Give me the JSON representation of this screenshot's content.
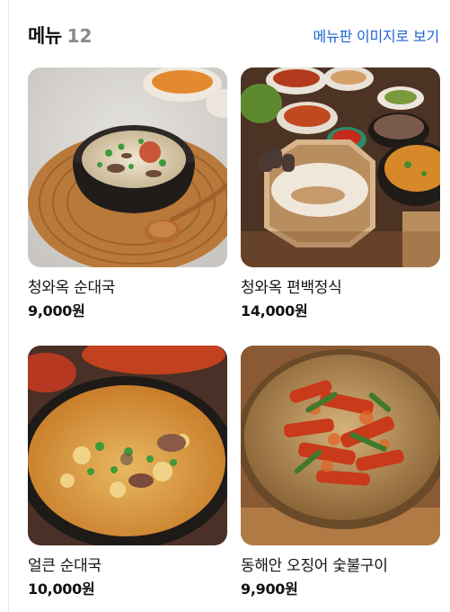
{
  "header": {
    "title": "메뉴",
    "count": "12",
    "view_menu_image": "메뉴판 이미지로 보기"
  },
  "menu_items": [
    {
      "name": "청와옥 순대국",
      "price": "9,000원",
      "image": "gukbap-bowl-photo"
    },
    {
      "name": "청와옥 편백정식",
      "price": "14,000원",
      "image": "steamed-sundae-set-photo"
    },
    {
      "name": "얼큰 순대국",
      "price": "10,000원",
      "image": "spicy-sundae-soup-photo"
    },
    {
      "name": "동해안 오징어 숯불구이",
      "price": "9,900원",
      "image": "grilled-squid-photo"
    }
  ],
  "colors": {
    "link": "#1f63d6",
    "count": "#8a8a8a",
    "text": "#111111"
  }
}
